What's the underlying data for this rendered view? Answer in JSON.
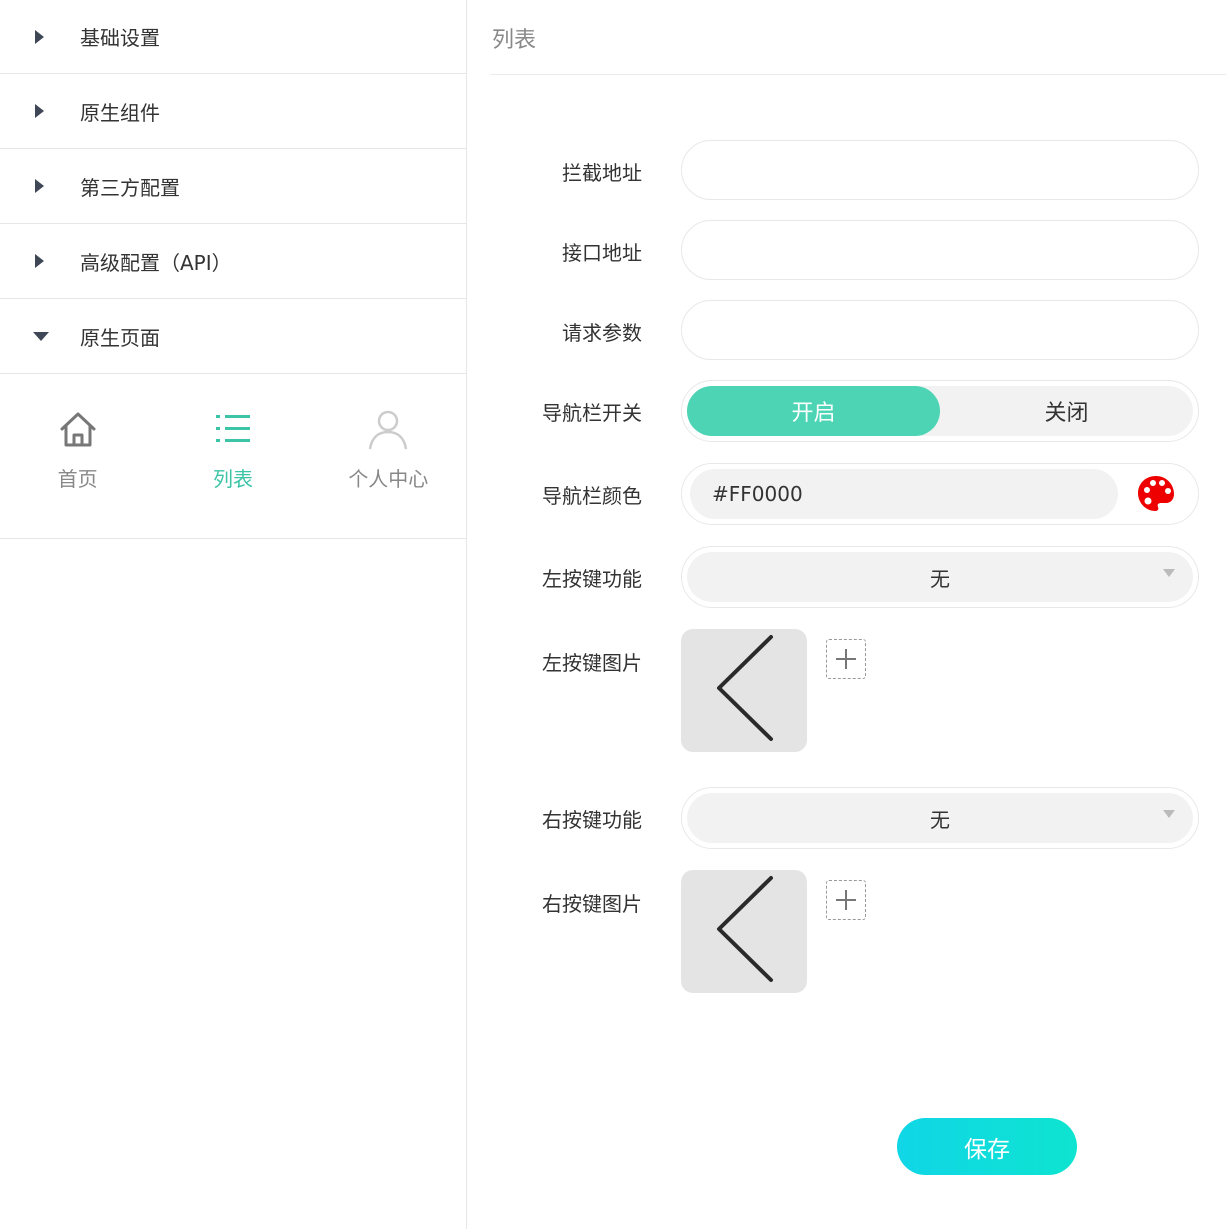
{
  "sidebar": {
    "items": [
      {
        "label": "基础设置",
        "expanded": false
      },
      {
        "label": "原生组件",
        "expanded": false
      },
      {
        "label": "第三方配置",
        "expanded": false
      },
      {
        "label": "高级配置（API）",
        "expanded": false
      },
      {
        "label": "原生页面",
        "expanded": true
      }
    ],
    "tabs": [
      {
        "label": "首页",
        "icon": "home-icon",
        "active": false
      },
      {
        "label": "列表",
        "icon": "list-icon",
        "active": true
      },
      {
        "label": "个人中心",
        "icon": "user-icon",
        "active": false
      }
    ]
  },
  "main": {
    "title": "列表",
    "fields": {
      "intercept_url": {
        "label": "拦截地址",
        "value": ""
      },
      "api_url": {
        "label": "接口地址",
        "value": ""
      },
      "request_params": {
        "label": "请求参数",
        "value": ""
      },
      "nav_switch": {
        "label": "导航栏开关",
        "on_label": "开启",
        "off_label": "关闭",
        "selected": "开启"
      },
      "nav_color": {
        "label": "导航栏颜色",
        "value": "#FF0000",
        "icon": "palette-icon"
      },
      "left_func": {
        "label": "左按键功能",
        "value": "无"
      },
      "left_img": {
        "label": "左按键图片",
        "icon": "chevron-left-icon"
      },
      "right_func": {
        "label": "右按键功能",
        "value": "无"
      },
      "right_img": {
        "label": "右按键图片",
        "icon": "chevron-left-icon"
      }
    },
    "save_label": "保存"
  },
  "colors": {
    "accent": "#4cd4b4",
    "tab_active": "#3cc4a7",
    "save_gradient_start": "#10d6e6",
    "save_gradient_end": "#0ee4d0",
    "palette": "#ff0000"
  }
}
